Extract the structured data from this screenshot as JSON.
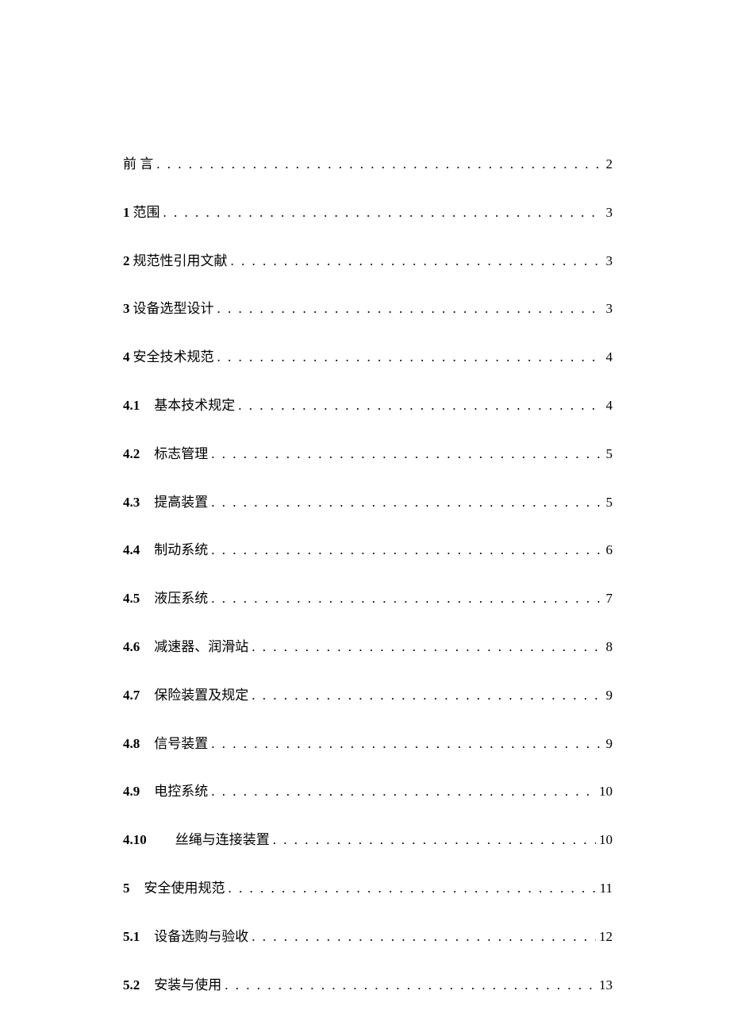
{
  "toc": {
    "entries": [
      {
        "num": "",
        "title": "前言",
        "page": "2",
        "indent": false,
        "spacedTitle": true
      },
      {
        "num": "1",
        "title": "范围",
        "page": "3",
        "indent": false,
        "spacedTitle": false
      },
      {
        "num": "2",
        "title": "规范性引用文献",
        "page": "3",
        "indent": false,
        "spacedTitle": false
      },
      {
        "num": "3",
        "title": "设备选型设计",
        "page": "3",
        "indent": false,
        "spacedTitle": false
      },
      {
        "num": "4",
        "title": "安全技术规范",
        "page": "4",
        "indent": false,
        "spacedTitle": false
      },
      {
        "num": "4.1",
        "title": "基本技术规定",
        "page": "4",
        "indent": true,
        "spacedTitle": false
      },
      {
        "num": "4.2",
        "title": "标志管理",
        "page": "5",
        "indent": true,
        "spacedTitle": false
      },
      {
        "num": "4.3",
        "title": "提高装置",
        "page": "5",
        "indent": true,
        "spacedTitle": false
      },
      {
        "num": "4.4",
        "title": "制动系统",
        "page": "6",
        "indent": true,
        "spacedTitle": false
      },
      {
        "num": "4.5",
        "title": "液压系统",
        "page": "7",
        "indent": true,
        "spacedTitle": false
      },
      {
        "num": "4.6",
        "title": "减速器、润滑站",
        "page": "8",
        "indent": true,
        "spacedTitle": false
      },
      {
        "num": "4.7",
        "title": "保险装置及规定",
        "page": "9",
        "indent": true,
        "spacedTitle": false
      },
      {
        "num": "4.8",
        "title": "信号装置",
        "page": "9",
        "indent": true,
        "spacedTitle": false
      },
      {
        "num": "4.9",
        "title": "电控系统",
        "page": "10",
        "indent": true,
        "spacedTitle": false
      },
      {
        "num": "4.10",
        "title": "丝绳与连接装置",
        "page": "10",
        "indent": true,
        "wideIndent": true,
        "spacedTitle": false
      },
      {
        "num": "5",
        "title": "安全使用规范",
        "page": "11",
        "indent": true,
        "spacedTitle": false
      },
      {
        "num": "5.1",
        "title": "设备选购与验收",
        "page": "12",
        "indent": true,
        "spacedTitle": false
      },
      {
        "num": "5.2",
        "title": "安装与使用",
        "page": "13",
        "indent": true,
        "spacedTitle": false
      }
    ]
  }
}
